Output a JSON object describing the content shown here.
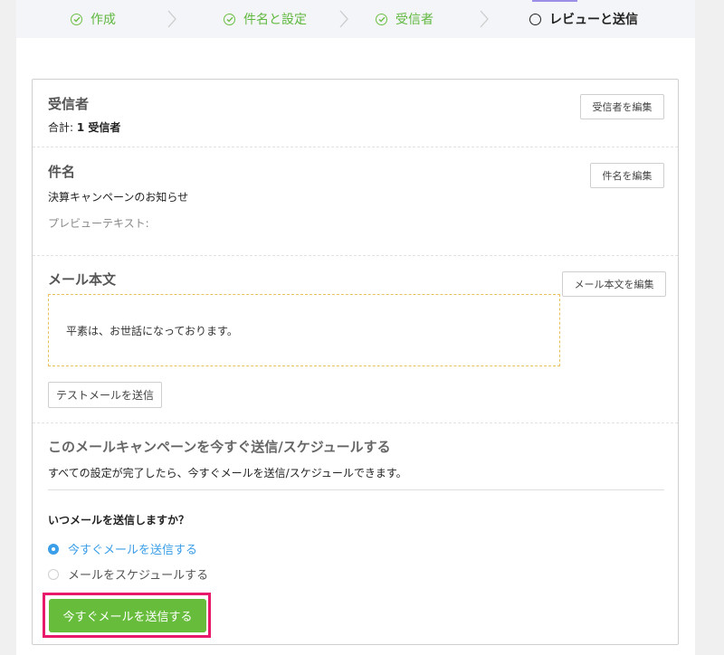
{
  "stepper": {
    "steps": [
      {
        "label": "作成",
        "state": "done"
      },
      {
        "label": "件名と設定",
        "state": "done"
      },
      {
        "label": "受信者",
        "state": "done"
      },
      {
        "label": "レビューと送信",
        "state": "current"
      }
    ]
  },
  "recipients": {
    "title": "受信者",
    "total_prefix": "合計: ",
    "total_value": "1 受信者",
    "edit_label": "受信者を編集"
  },
  "subject": {
    "title": "件名",
    "value": "決算キャンペーンのお知らせ",
    "preview_label": "プレビューテキスト:",
    "edit_label": "件名を編集"
  },
  "body": {
    "title": "メール本文",
    "text": "平素は、お世話になっております。",
    "edit_label": "メール本文を編集",
    "test_label": "テストメールを送信"
  },
  "send": {
    "title": "このメールキャンペーンを今すぐ送信/スケジュールする",
    "description": "すべての設定が完了したら、今すぐメールを送信/スケジュールできます。",
    "question": "いつメールを送信しますか？",
    "options": [
      {
        "label": "今すぐメールを送信する",
        "selected": true
      },
      {
        "label": "メールをスケジュールする",
        "selected": false
      }
    ],
    "button_label": "今すぐメールを送信する"
  },
  "colors": {
    "done_green": "#5fb83f",
    "accent_blue": "#3a9ee8",
    "button_green": "#67bd3b",
    "highlight_pink": "#e8196b"
  }
}
